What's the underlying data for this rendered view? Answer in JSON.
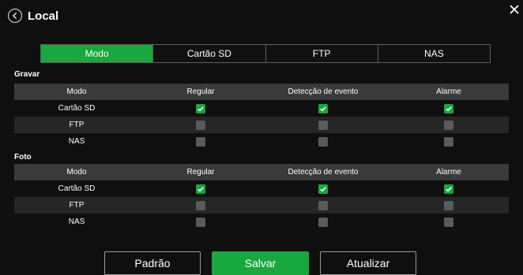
{
  "header": {
    "title": "Local"
  },
  "tabs": [
    {
      "label": "Modo",
      "active": true
    },
    {
      "label": "Cartão SD",
      "active": false
    },
    {
      "label": "FTP",
      "active": false
    },
    {
      "label": "NAS",
      "active": false
    }
  ],
  "sections": [
    {
      "title": "Gravar",
      "columns": [
        "Modo",
        "Regular",
        "Detecção de evento",
        "Alarme"
      ],
      "rows": [
        {
          "label": "Cartão SD",
          "checks": [
            true,
            true,
            true
          ]
        },
        {
          "label": "FTP",
          "checks": [
            false,
            false,
            false
          ]
        },
        {
          "label": "NAS",
          "checks": [
            false,
            false,
            false
          ]
        }
      ]
    },
    {
      "title": "Foto",
      "columns": [
        "Modo",
        "Regular",
        "Detecção de evento",
        "Alarme"
      ],
      "rows": [
        {
          "label": "Cartão SD",
          "checks": [
            true,
            true,
            true
          ]
        },
        {
          "label": "FTP",
          "checks": [
            false,
            false,
            false
          ]
        },
        {
          "label": "NAS",
          "checks": [
            false,
            false,
            false
          ]
        }
      ]
    }
  ],
  "buttons": {
    "default": "Padrão",
    "save": "Salvar",
    "refresh": "Atualizar"
  },
  "colors": {
    "accent": "#18a83d",
    "unchecked": "#5a5a5a",
    "background": "#0f0f0f",
    "header_row": "#3a3a3a",
    "alt_row": "#262626"
  }
}
